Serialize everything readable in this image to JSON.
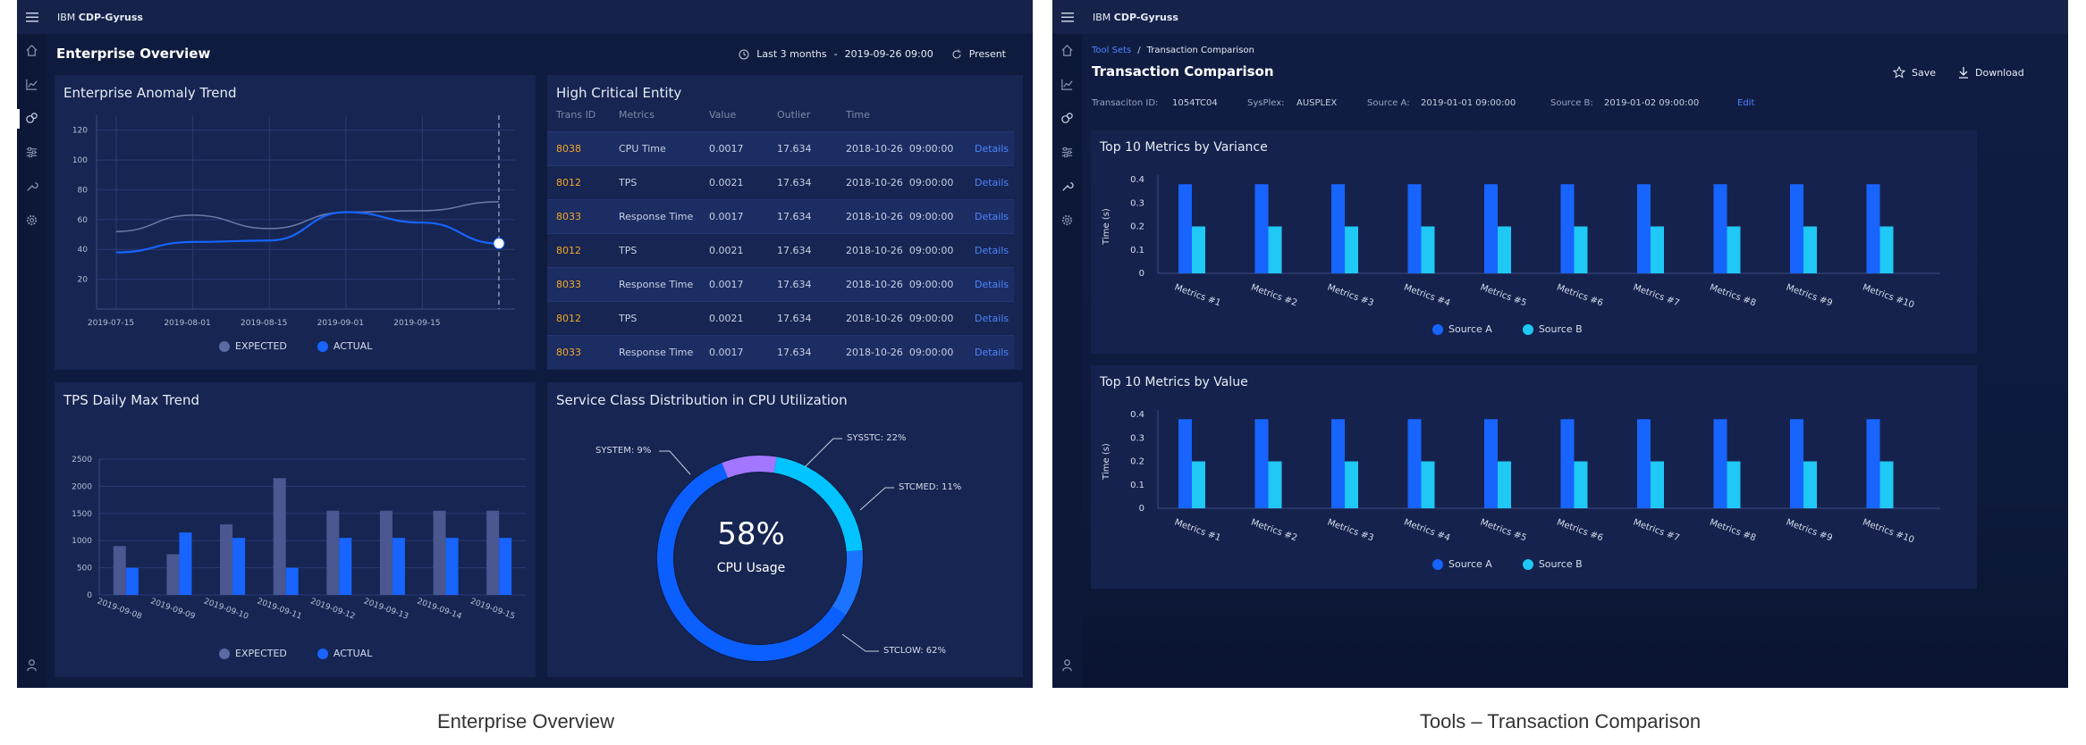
{
  "left": {
    "brand_prefix": "IBM",
    "brand_name": "CDP-Gyruss",
    "page_title": "Enterprise Overview",
    "time_range": "Last 3 months",
    "date_sep": "-",
    "timestamp": "2019-09-26  09:00",
    "refresh_label": "Present",
    "anomaly": {
      "title": "Enterprise Anomaly Trend",
      "yticks": [
        "120",
        "100",
        "80",
        "60",
        "40",
        "20"
      ],
      "xticks": [
        "2019-07-15",
        "2019-08-01",
        "2019-08-15",
        "2019-09-01",
        "2019-09-15"
      ],
      "legend_expected": "EXPECTED",
      "legend_actual": "ACTUAL"
    },
    "entity": {
      "title": "High Critical Entity",
      "columns": [
        "Trans ID",
        "Metrics",
        "Value",
        "Outlier",
        "Time"
      ],
      "rows": [
        {
          "id": "8038",
          "metric": "CPU Time",
          "value": "0.0017",
          "outlier": "17.634",
          "time": "2018-10-26  09:00:00",
          "action": "Details"
        },
        {
          "id": "8012",
          "metric": "TPS",
          "value": "0.0021",
          "outlier": "17.634",
          "time": "2018-10-26  09:00:00",
          "action": "Details"
        },
        {
          "id": "8033",
          "metric": "Response Time",
          "value": "0.0017",
          "outlier": "17.634",
          "time": "2018-10-26  09:00:00",
          "action": "Details"
        },
        {
          "id": "8012",
          "metric": "TPS",
          "value": "0.0021",
          "outlier": "17.634",
          "time": "2018-10-26  09:00:00",
          "action": "Details"
        },
        {
          "id": "8033",
          "metric": "Response Time",
          "value": "0.0017",
          "outlier": "17.634",
          "time": "2018-10-26  09:00:00",
          "action": "Details"
        },
        {
          "id": "8012",
          "metric": "TPS",
          "value": "0.0021",
          "outlier": "17.634",
          "time": "2018-10-26  09:00:00",
          "action": "Details"
        },
        {
          "id": "8033",
          "metric": "Response Time",
          "value": "0.0017",
          "outlier": "17.634",
          "time": "2018-10-26  09:00:00",
          "action": "Details"
        }
      ]
    },
    "tps": {
      "title": "TPS Daily Max Trend",
      "legend_expected": "EXPECTED",
      "legend_actual": "ACTUAL"
    },
    "donut": {
      "title": "Service Class Distribution in CPU Utilization",
      "center_value": "58%",
      "center_label": "CPU Usage",
      "labels": {
        "system": "SYSTEM: 9%",
        "sysstc": "SYSSTC: 22%",
        "stcmed": "STCMED: 11%",
        "stclow": "STCLOW: 62%"
      }
    },
    "caption": "Enterprise Overview"
  },
  "right": {
    "brand_prefix": "IBM",
    "brand_name": "CDP-Gyruss",
    "breadcrumb_root": "Tool Sets",
    "breadcrumb_sep": "/",
    "breadcrumb_current": "Transaction Comparison",
    "page_title": "Transaction Comparison",
    "save_label": "Save",
    "download_label": "Download",
    "meta": {
      "trans_label": "Transaciton ID:",
      "trans_value": "1054TC04",
      "sysplex_label": "SysPlex:",
      "sysplex_value": "AUSPLEX",
      "source_a_label": "Source A:",
      "source_a_value": "2019-01-01  09:00:00",
      "source_b_label": "Source B:",
      "source_b_value": "2019-01-02  09:00:00",
      "edit_label": "Edit"
    },
    "chart1_title": "Top 10 Metrics by Variance",
    "chart2_title": "Top 10 Metrics by Value",
    "ylabel": "Time (s)",
    "yticks": [
      "0.4",
      "0.3",
      "0.2",
      "0.1",
      "0"
    ],
    "legend_a": "Source A",
    "legend_b": "Source B",
    "caption": "Tools – Transaction Comparison"
  },
  "chart_data": [
    {
      "type": "line",
      "title": "Enterprise Anomaly Trend",
      "x": [
        "2019-07-15",
        "2019-08-01",
        "2019-08-15",
        "2019-09-01",
        "2019-09-15",
        "2019-09-26"
      ],
      "ylim": [
        0,
        130
      ],
      "series": [
        {
          "name": "EXPECTED",
          "values": [
            52,
            63,
            54,
            65,
            66,
            72
          ]
        },
        {
          "name": "ACTUAL",
          "values": [
            38,
            45,
            46,
            65,
            58,
            44
          ]
        }
      ]
    },
    {
      "type": "bar",
      "title": "TPS Daily Max Trend",
      "categories": [
        "2019-09-08",
        "2019-09-09",
        "2019-09-10",
        "2019-09-11",
        "2019-09-12",
        "2019-09-13",
        "2019-09-14",
        "2019-09-15"
      ],
      "ylim": [
        0,
        2500
      ],
      "yticks": [
        "2500",
        "2000",
        "1500",
        "1000",
        "500",
        "0"
      ],
      "series": [
        {
          "name": "EXPECTED",
          "values": [
            900,
            750,
            1300,
            2150,
            1550,
            1550,
            1550,
            1550
          ]
        },
        {
          "name": "ACTUAL",
          "values": [
            500,
            1150,
            1050,
            500,
            1050,
            1050,
            1050,
            1050
          ]
        }
      ]
    },
    {
      "type": "pie",
      "title": "Service Class Distribution in CPU Utilization",
      "categories": [
        "SYSTEM",
        "SYSSTC",
        "STCMED",
        "STCLOW"
      ],
      "values": [
        9,
        22,
        11,
        62
      ]
    },
    {
      "type": "bar",
      "title": "Top 10 Metrics by Variance",
      "categories": [
        "Metrics #1",
        "Metrics #2",
        "Metrics #3",
        "Metrics #4",
        "Metrics #5",
        "Metrics #6",
        "Metrics #7",
        "Metrics #8",
        "Metrics #9",
        "Metrics #10"
      ],
      "ylabel": "Time (s)",
      "ylim": [
        0,
        0.4
      ],
      "series": [
        {
          "name": "Source A",
          "values": [
            0.38,
            0.38,
            0.38,
            0.38,
            0.38,
            0.38,
            0.38,
            0.38,
            0.38,
            0.38
          ]
        },
        {
          "name": "Source B",
          "values": [
            0.2,
            0.2,
            0.2,
            0.2,
            0.2,
            0.2,
            0.2,
            0.2,
            0.2,
            0.2
          ]
        }
      ]
    },
    {
      "type": "bar",
      "title": "Top 10 Metrics by Value",
      "categories": [
        "Metrics #1",
        "Metrics #2",
        "Metrics #3",
        "Metrics #4",
        "Metrics #5",
        "Metrics #6",
        "Metrics #7",
        "Metrics #8",
        "Metrics #9",
        "Metrics #10"
      ],
      "ylabel": "Time (s)",
      "ylim": [
        0,
        0.4
      ],
      "series": [
        {
          "name": "Source A",
          "values": [
            0.38,
            0.38,
            0.38,
            0.38,
            0.38,
            0.38,
            0.38,
            0.38,
            0.38,
            0.38
          ]
        },
        {
          "name": "Source B",
          "values": [
            0.2,
            0.2,
            0.2,
            0.2,
            0.2,
            0.2,
            0.2,
            0.2,
            0.2,
            0.2
          ]
        }
      ]
    }
  ]
}
